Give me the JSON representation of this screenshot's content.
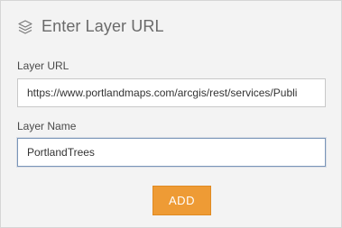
{
  "header": {
    "title": "Enter Layer URL",
    "icon": "layers-icon"
  },
  "form": {
    "url_label": "Layer URL",
    "url_value": "https://www.portlandmaps.com/arcgis/rest/services/Publi",
    "name_label": "Layer Name",
    "name_value": "PortlandTrees"
  },
  "actions": {
    "add_label": "ADD"
  },
  "colors": {
    "panel_bg": "#f3f3f3",
    "button_orange": "#ee9b35",
    "focus_border": "#7a95b8"
  }
}
